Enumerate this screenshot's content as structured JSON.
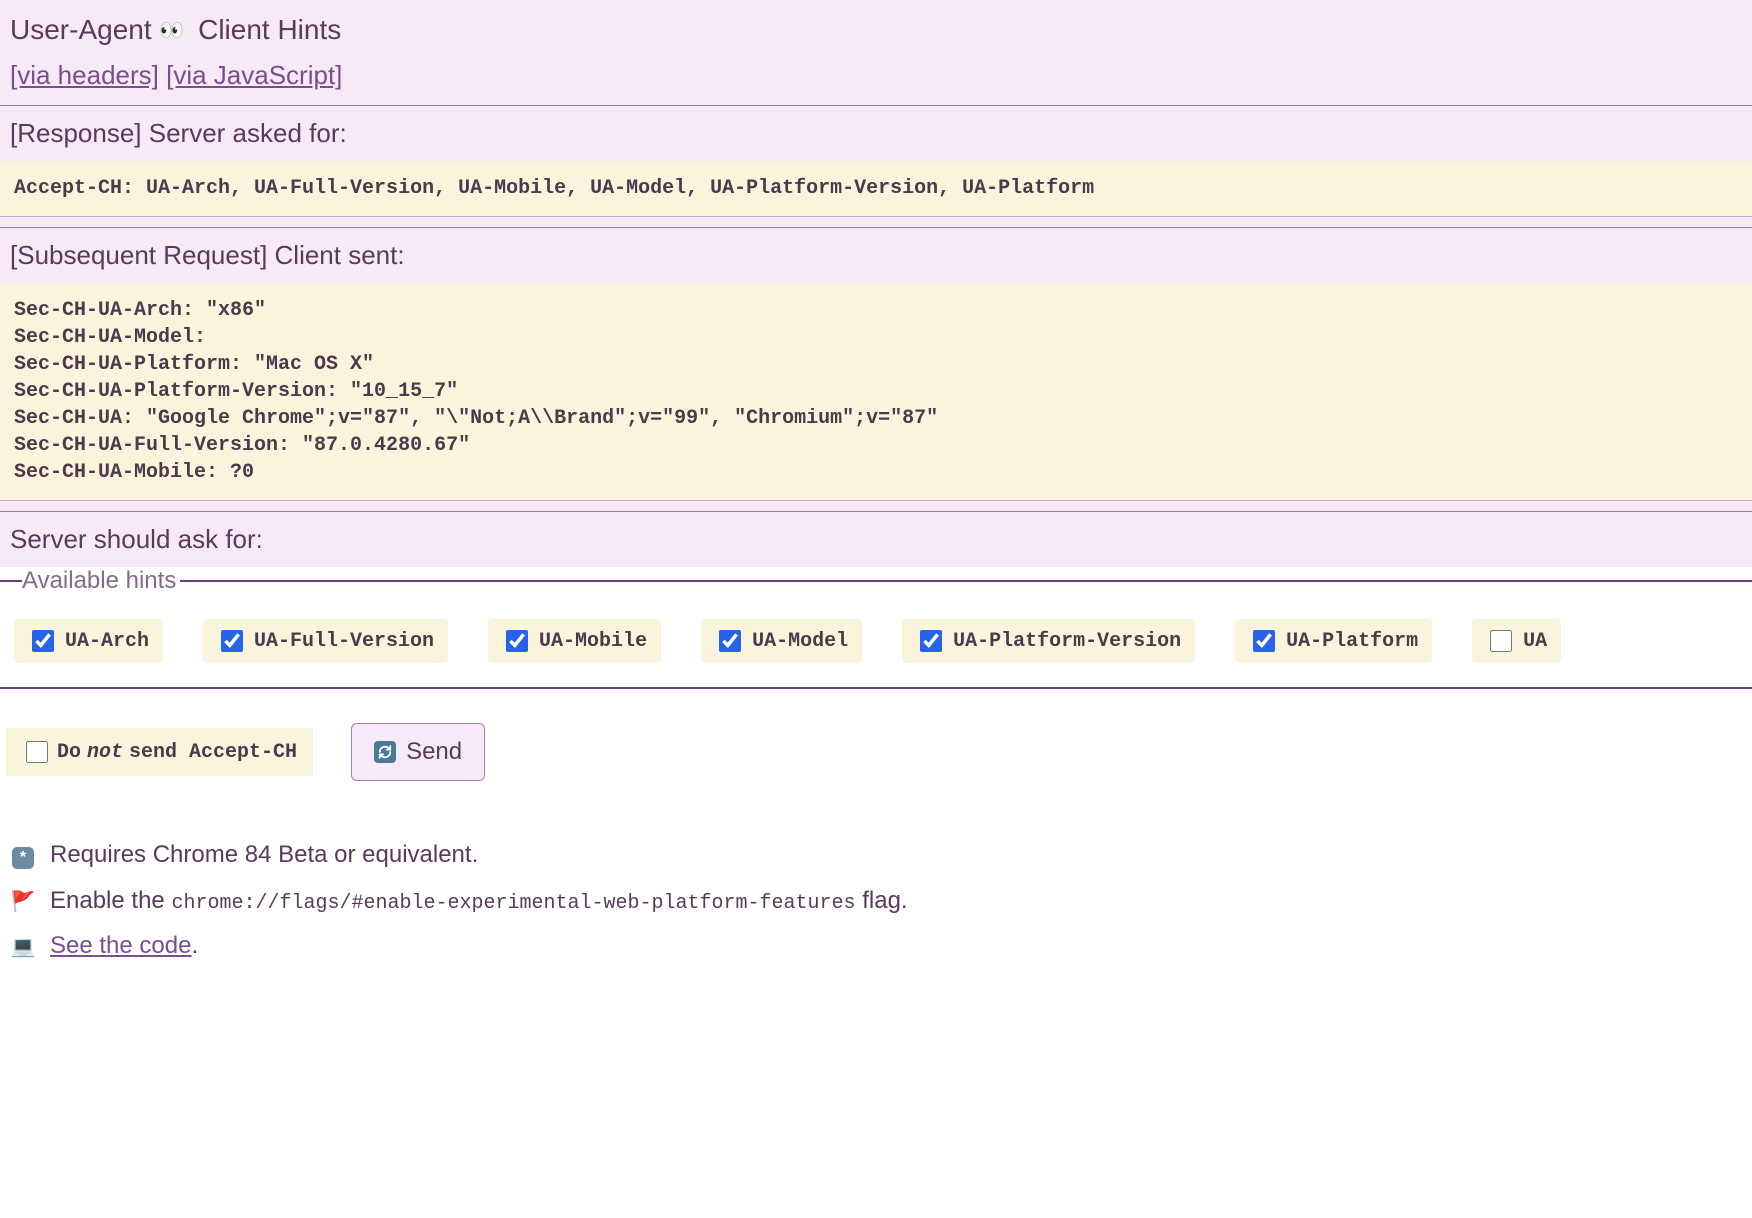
{
  "titlePrefix": "User-Agent",
  "titleSuffix": "Client Hints",
  "nav": {
    "viaHeaders": "[via headers]",
    "viaJs": "[via JavaScript]"
  },
  "sections": {
    "response": "[Response] Server asked for:",
    "subsequent": "[Subsequent Request] Client sent:",
    "should": "Server should ask for:"
  },
  "codeResponse": "Accept-CH: UA-Arch, UA-Full-Version, UA-Mobile, UA-Model, UA-Platform-Version, UA-Platform",
  "codeSubsequent": "Sec-CH-UA-Arch: \"x86\"\nSec-CH-UA-Model:\nSec-CH-UA-Platform: \"Mac OS X\"\nSec-CH-UA-Platform-Version: \"10_15_7\"\nSec-CH-UA: \"Google Chrome\";v=\"87\", \"\\\"Not;A\\\\Brand\";v=\"99\", \"Chromium\";v=\"87\"\nSec-CH-UA-Full-Version: \"87.0.4280.67\"\nSec-CH-UA-Mobile: ?0",
  "legend": "Available hints",
  "hints": [
    {
      "label": "UA-Arch",
      "checked": true
    },
    {
      "label": "UA-Full-Version",
      "checked": true
    },
    {
      "label": "UA-Mobile",
      "checked": true
    },
    {
      "label": "UA-Model",
      "checked": true
    },
    {
      "label": "UA-Platform-Version",
      "checked": true
    },
    {
      "label": "UA-Platform",
      "checked": true
    },
    {
      "label": "UA",
      "checked": false
    }
  ],
  "doNotSend": {
    "prefix": "Do",
    "not": "not",
    "suffix": "send Accept-CH",
    "checked": false
  },
  "sendLabel": "Send",
  "notes": {
    "requires": "Requires Chrome 84 Beta or equivalent.",
    "enablePrefix": "Enable the",
    "enableCode": "chrome://flags/#enable-experimental-web-platform-features",
    "enableSuffix": "flag.",
    "seeCode": "See the code"
  }
}
